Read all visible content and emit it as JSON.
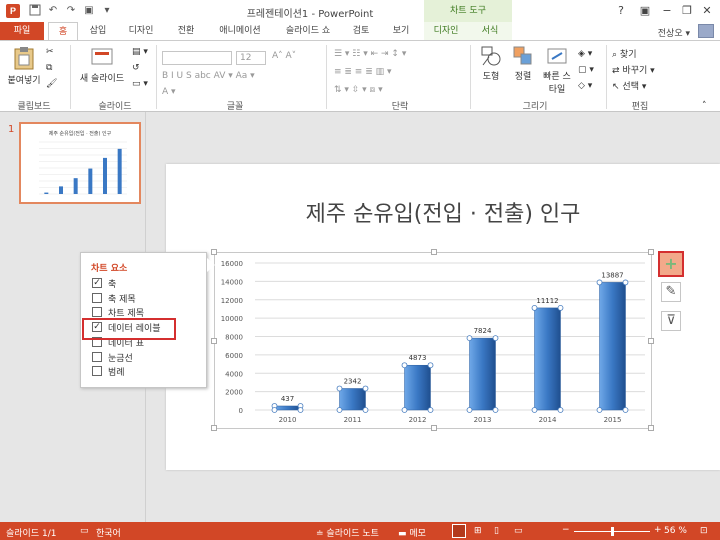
{
  "window": {
    "title": "프레젠테이션1 - PowerPoint",
    "app_icon_letter": "P",
    "context_group": "차트 도구",
    "help": "?",
    "minimize": "−",
    "restore": "❐",
    "close": "✕",
    "user_name": "전상오 ▾"
  },
  "tabs": [
    {
      "label": "파일"
    },
    {
      "label": "홈"
    },
    {
      "label": "삽입"
    },
    {
      "label": "디자인"
    },
    {
      "label": "전환"
    },
    {
      "label": "애니메이션"
    },
    {
      "label": "슬라이드 쇼"
    },
    {
      "label": "검토"
    },
    {
      "label": "보기"
    },
    {
      "label": "디자인"
    },
    {
      "label": "서식"
    }
  ],
  "ribbon": {
    "groups": {
      "clipboard": "클립보드",
      "slides": "슬라이드",
      "font": "글꼴",
      "paragraph": "단락",
      "drawing": "그리기",
      "editing": "편집"
    },
    "paste": "붙여넣기",
    "new_slide": "새 슬라이드",
    "font_size": "12",
    "shapes": "도형",
    "arrange": "정렬",
    "quick_styles": "빠른 스타일",
    "find": "찾기",
    "replace": "바꾸기",
    "select": "선택"
  },
  "thumbnail": {
    "number": "1",
    "title": "제주 순유입(전입 · 전출) 인구"
  },
  "slide": {
    "title": "제주 순유입(전입 · 전출) 인구"
  },
  "chart_data": {
    "type": "bar",
    "title": "",
    "categories": [
      "2010",
      "2011",
      "2012",
      "2013",
      "2014",
      "2015"
    ],
    "values": [
      437,
      2342,
      4873,
      7824,
      11112,
      13887
    ],
    "data_labels": [
      "437",
      "2342",
      "4873",
      "7824",
      "11112",
      "13887"
    ],
    "yticks": [
      "0",
      "2000",
      "4000",
      "6000",
      "8000",
      "10000",
      "12000",
      "14000",
      "16000"
    ],
    "ylim": [
      0,
      16000
    ],
    "xlabel": "",
    "ylabel": "",
    "grid": true,
    "bar_color": "#3a78c4"
  },
  "flyout": {
    "title": "차트 요소",
    "items": [
      {
        "label": "축",
        "checked": true
      },
      {
        "label": "축 제목",
        "checked": false
      },
      {
        "label": "차트 제목",
        "checked": false
      },
      {
        "label": "데이터 레이블",
        "checked": true
      },
      {
        "label": "데이터 표",
        "checked": false
      },
      {
        "label": "눈금선",
        "checked": false
      },
      {
        "label": "범례",
        "checked": false
      }
    ]
  },
  "side_buttons": {
    "elements": "+",
    "styles": "✎",
    "filter": "⊽"
  },
  "status": {
    "slide_info": "슬라이드 1/1",
    "language": "한국어",
    "notes": "슬라이드 노트",
    "comments": "메모",
    "zoom_minus": "−",
    "zoom_plus": "+",
    "zoom": "56 %",
    "zoom_fraction": 0.56
  },
  "colors": {
    "accent": "#d24726",
    "context": "#3d7a1f",
    "highlight": "#d42f2f"
  }
}
